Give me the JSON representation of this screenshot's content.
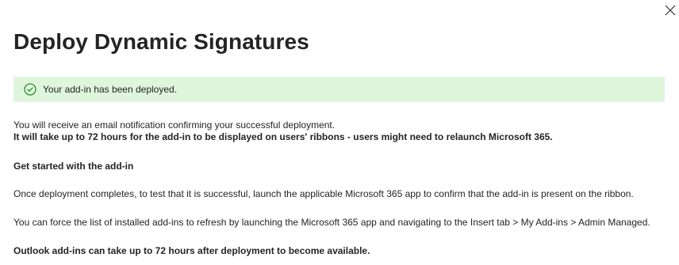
{
  "dialog": {
    "title": "Deploy Dynamic Signatures",
    "close_icon": "close-icon",
    "banner": {
      "icon": "checkmark-circle-icon",
      "text": "Your add-in has been deployed.",
      "background": "#dff6dd",
      "icon_color": "#107c10"
    },
    "body": {
      "notification": "You will receive an email notification confirming your successful deployment.",
      "ribbon_notice": "It will take up to 72 hours for the add-in to be displayed on users' ribbons - users might need to relaunch Microsoft 365.",
      "get_started_heading": "Get started with the add-in",
      "test_instructions": "Once deployment completes, to test that it is successful, launch the applicable Microsoft 365 app to confirm that the add-in is present on the ribbon.",
      "refresh_instructions": "You can force the list of installed add-ins to refresh by launching the Microsoft 365 app and navigating to the Insert tab > My Add-ins > Admin Managed.",
      "outlook_notice": "Outlook add-ins can take up to 72 hours after deployment to become available."
    }
  }
}
